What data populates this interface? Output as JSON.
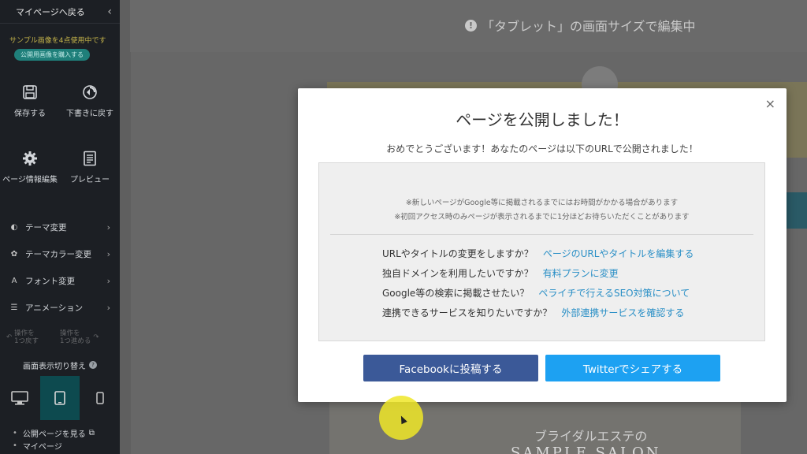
{
  "sidebar": {
    "back_label": "マイページへ戻る",
    "sample_text": "サンプル画像を4点使用中です",
    "pill_label": "公開用画像を購入する",
    "tiles": [
      {
        "label": "保存する",
        "icon": "save-icon"
      },
      {
        "label": "下書きに戻す",
        "icon": "revert-icon"
      },
      {
        "label": "ページ情報編集",
        "icon": "gear-icon"
      },
      {
        "label": "プレビュー",
        "icon": "preview-icon"
      }
    ],
    "menu": [
      {
        "label": "テーマ変更",
        "icon": "theme-icon"
      },
      {
        "label": "テーマカラー変更",
        "icon": "palette-icon"
      },
      {
        "label": "フォント変更",
        "icon": "font-icon"
      },
      {
        "label": "アニメーション",
        "icon": "animation-icon"
      }
    ],
    "undo": {
      "line1": "操作を",
      "line2": "1つ戻す"
    },
    "redo": {
      "line1": "操作を",
      "line2": "1つ進める"
    },
    "screen_switch_label": "画面表示切り替え",
    "devices": [
      "desktop",
      "tablet",
      "mobile"
    ],
    "active_device": "tablet",
    "links": [
      "公開ページを見る",
      "マイページ"
    ]
  },
  "editor": {
    "banner": "「タブレット」の画面サイズで編集中",
    "bg_text1": "ブライダルエステの",
    "bg_text2": "SAMPLE SALON"
  },
  "modal": {
    "close_glyph": "×",
    "title": "ページを公開しました！",
    "subtitle": "おめでとうございます！あなたのページは以下のURLで公開されました！",
    "notices": [
      "※新しいページがGoogle等に掲載されるまでにはお時間がかかる場合があります",
      "※初回アクセス時のみページが表示されるまでに1分ほどお待ちいただくことがあります"
    ],
    "qa": [
      {
        "question": "URLやタイトルの変更をしますか？",
        "link": "ページのURLやタイトルを編集する"
      },
      {
        "question": "独自ドメインを利用したいですか？",
        "link": "有料プランに変更"
      },
      {
        "question": "Google等の検索に掲載させたい？",
        "link": "ペライチで行えるSEO対策について"
      },
      {
        "question": "連携できるサービスを知りたいですか？",
        "link": "外部連携サービスを確認する"
      }
    ],
    "facebook_button": "Facebookに投稿する",
    "twitter_button": "Twitterでシェアする"
  },
  "colors": {
    "facebook": "#3b5998",
    "twitter": "#1da1f2",
    "link": "#2a8fc6",
    "sidebar_bg": "#1c1f24"
  }
}
